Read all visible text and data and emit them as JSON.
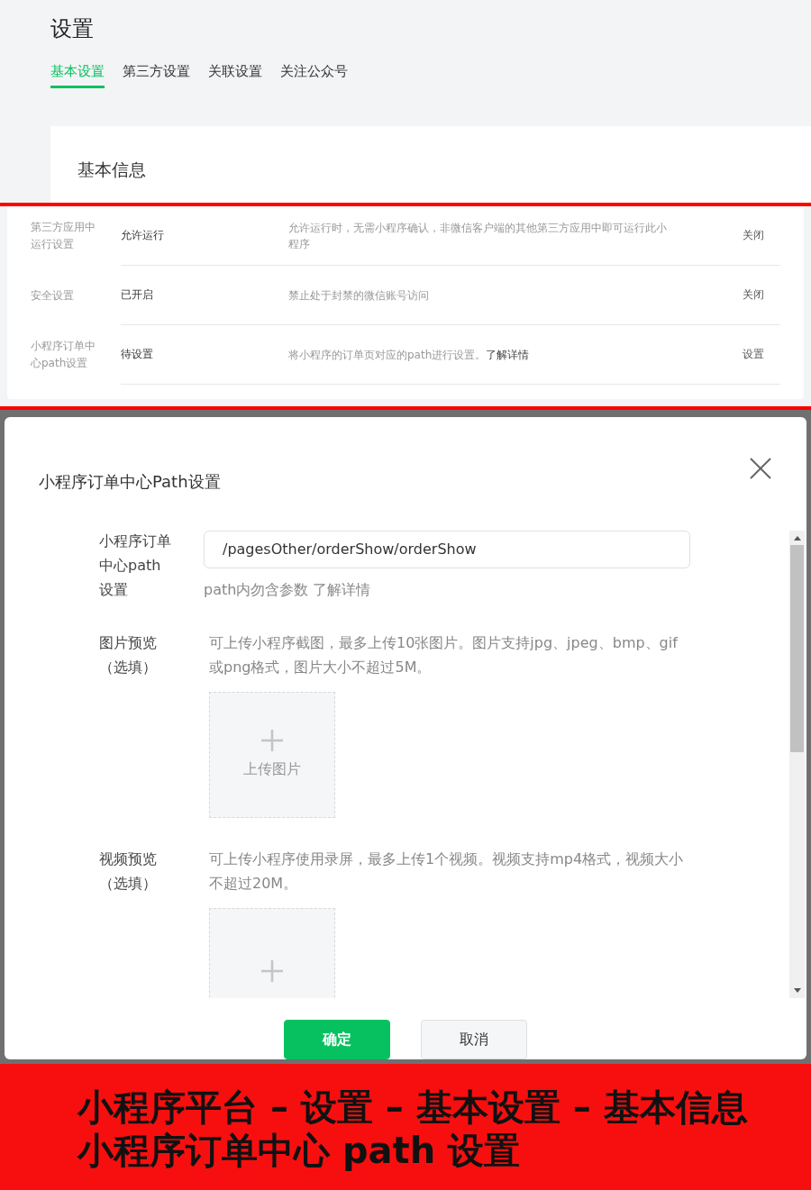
{
  "page": {
    "title": "设置",
    "tabs": [
      {
        "label": "基本设置",
        "selected": true
      },
      {
        "label": "第三方设置",
        "selected": false
      },
      {
        "label": "关联设置",
        "selected": false
      },
      {
        "label": "关注公众号",
        "selected": false
      }
    ]
  },
  "card": {
    "title": "基本信息"
  },
  "settings_rows": [
    {
      "label": "第三方应用中运行设置",
      "status": "允许运行",
      "description": "允许运行时，无需小程序确认，非微信客户端的其他第三方应用中即可运行此小程序",
      "action": "关闭"
    },
    {
      "label": "安全设置",
      "status": "已开启",
      "description": "禁止处于封禁的微信账号访问",
      "action": "关闭"
    },
    {
      "label": "小程序订单中心path设置",
      "status": "待设置",
      "description": "将小程序的订单页对应的path进行设置。",
      "link": "了解详情",
      "action": "设置"
    }
  ],
  "dialog": {
    "title": "小程序订单中心Path设置",
    "fields": [
      {
        "kind": "input",
        "label": "小程序订单中心path设置",
        "value": "/pagesOther/orderShow/orderShow",
        "hint": "path内勿含参数 了解详情"
      },
      {
        "kind": "upload",
        "label": "图片预览（选填）",
        "hint": "可上传小程序截图，最多上传10张图片。图片支持jpg、jpeg、bmp、gif或png格式，图片大小不超过5M。",
        "upload_label": "上传图片"
      },
      {
        "kind": "upload",
        "label": "视频预览（选填）",
        "hint": "可上传小程序使用录屏，最多上传1个视频。视频支持mp4格式，视频大小不超过20M。"
      }
    ],
    "buttons": [
      {
        "label": "确定",
        "kind": "primary"
      },
      {
        "label": "取消",
        "kind": "secondary"
      }
    ]
  },
  "caption": [
    "小程序平台 – 设置 – 基本设置 – 基本信息",
    "小程序订单中心 path 设置"
  ]
}
